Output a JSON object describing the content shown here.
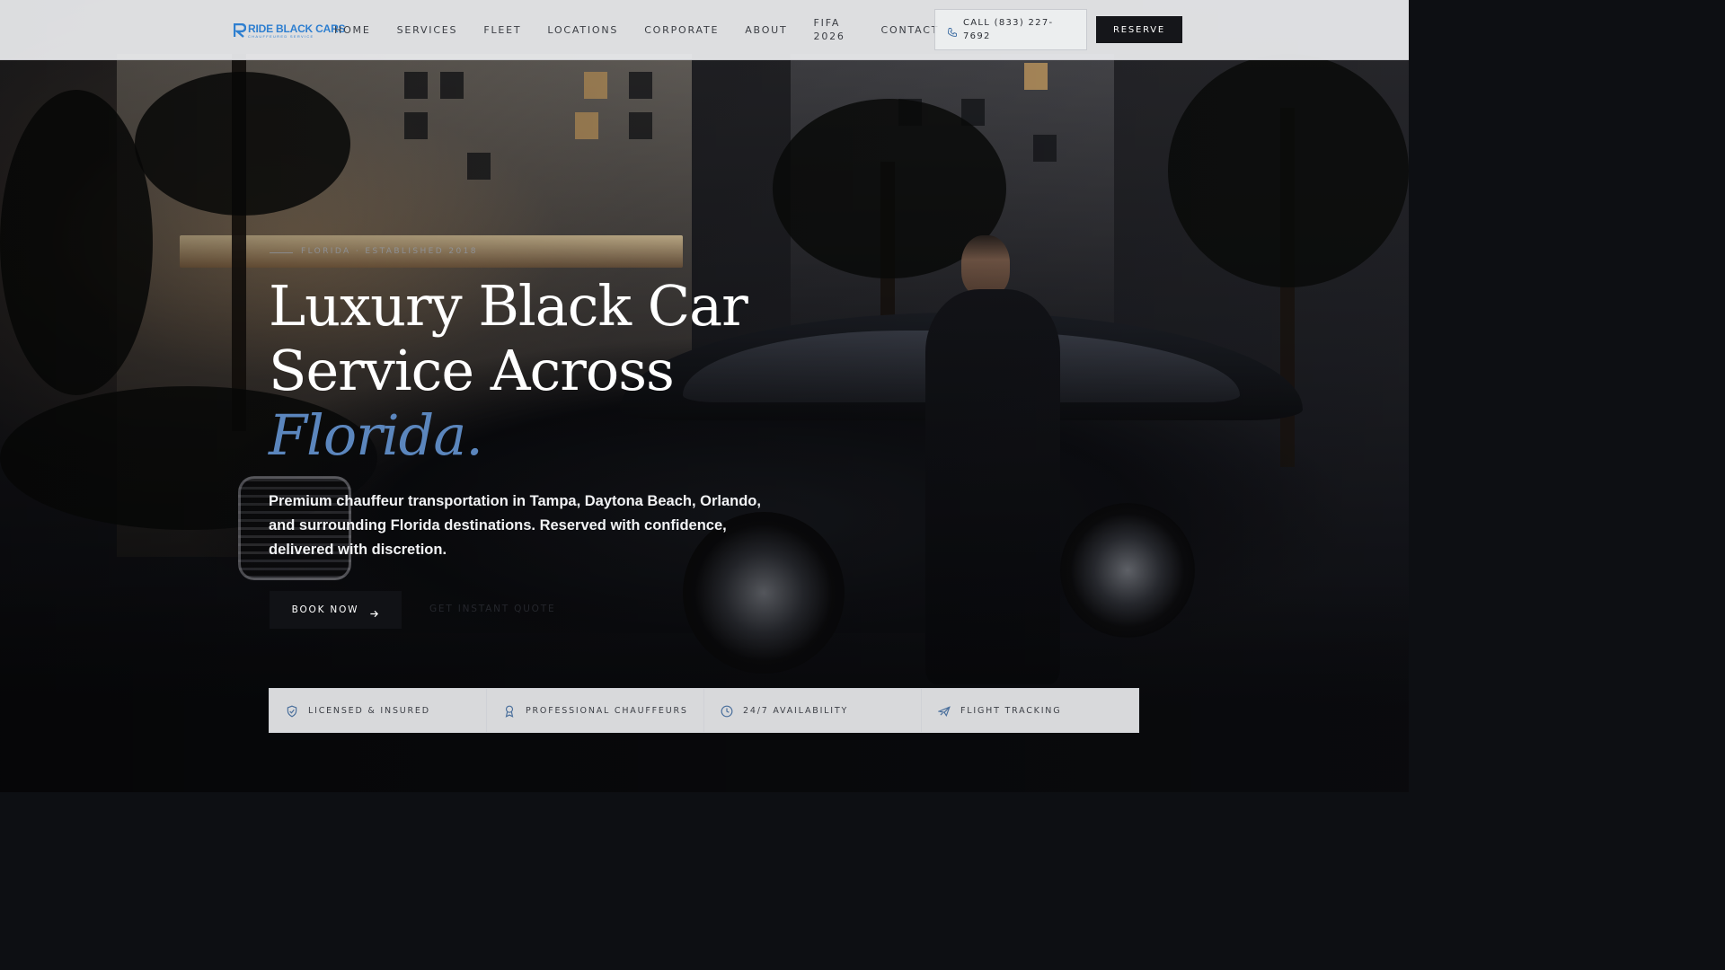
{
  "brand": {
    "name": "RIDE BLACK CARS",
    "tagline": "CHAUFFEURED SERVICE",
    "accent_color": "#2e7fd0"
  },
  "nav": {
    "links": [
      {
        "label": "HOME"
      },
      {
        "label": "SERVICES"
      },
      {
        "label": "FLEET"
      },
      {
        "label": "LOCATIONS"
      },
      {
        "label": "CORPORATE"
      },
      {
        "label": "ABOUT"
      },
      {
        "label": "FIFA 2026"
      },
      {
        "label": "CONTACT"
      }
    ],
    "call_label": "CALL (833) 227-7692",
    "call_icon": "phone-icon",
    "reserve_label": "RESERVE"
  },
  "hero": {
    "eyebrow": "FLORIDA · ESTABLISHED 2018",
    "headline_line1": "Luxury Black Car",
    "headline_line2": "Service Across",
    "headline_accent": "Florida.",
    "accent_color": "#5b86bd",
    "subtext": "Premium chauffeur transportation in Tampa, Daytona Beach, Orlando, and surrounding Florida destinations. Reserved with confidence, delivered with discretion.",
    "primary_cta": "BOOK NOW",
    "primary_cta_icon": "arrow-right-icon",
    "secondary_cta": "GET INSTANT QUOTE"
  },
  "features": [
    {
      "icon": "shield-check-icon",
      "label": "LICENSED & INSURED"
    },
    {
      "icon": "award-icon",
      "label": "PROFESSIONAL CHAUFFEURS"
    },
    {
      "icon": "clock-icon",
      "label": "24/7 AVAILABILITY"
    },
    {
      "icon": "plane-icon",
      "label": "FLIGHT TRACKING"
    }
  ]
}
